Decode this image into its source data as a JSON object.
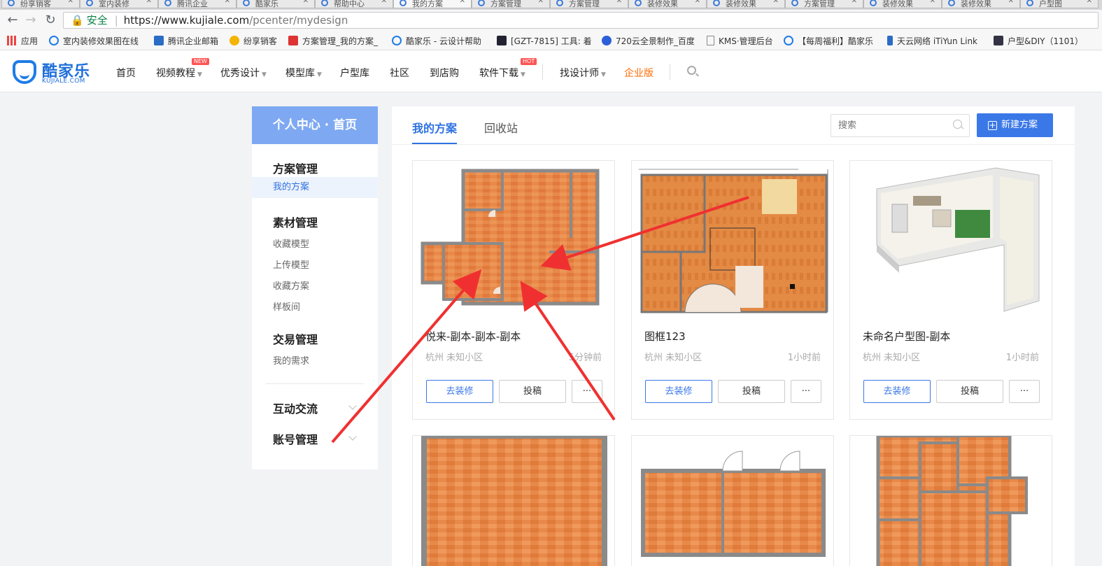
{
  "browser": {
    "tabs": [
      "纷享销客",
      "室内装修",
      "腾讯企业",
      "酷家乐",
      "帮助中心",
      "我的方案",
      "方案管理",
      "方案管理",
      "装修效果",
      "装修效果",
      "方案管理",
      "装修效果",
      "装修效果",
      "户型图"
    ],
    "address": {
      "secure_label": "安全",
      "host": "https://www.kujiale.com",
      "path": "/pcenter/mydesign"
    },
    "bookmarks": [
      "应用",
      "室内装修效果图在线",
      "腾讯企业邮箱",
      "纷享销客",
      "方案管理_我的方案_",
      "酷家乐 - 云设计帮助",
      "[GZT-7815] 工具: 着",
      "720云全景制作_百度",
      "KMS·管理后台",
      "【每周福利】酷家乐",
      "天云网络 iTiYun Link",
      "户型&DIY（1101）"
    ]
  },
  "header": {
    "logo_cn": "酷家乐",
    "logo_en": "KUJIALE.COM",
    "nav": [
      {
        "label": "首页",
        "caret": false
      },
      {
        "label": "视频教程",
        "caret": true,
        "badge": "NEW"
      },
      {
        "label": "优秀设计",
        "caret": true
      },
      {
        "label": "模型库",
        "caret": true
      },
      {
        "label": "户型库",
        "caret": false
      },
      {
        "label": "社区",
        "caret": false
      },
      {
        "label": "到店购",
        "caret": false
      },
      {
        "label": "软件下载",
        "caret": true,
        "badge": "HOT"
      },
      {
        "label": "找设计师",
        "caret": true
      },
      {
        "label": "企业版",
        "caret": false
      }
    ]
  },
  "sidebar": {
    "home": "个人中心 · 首页",
    "groups": [
      {
        "title": "方案管理",
        "items": [
          "我的方案"
        ]
      },
      {
        "title": "素材管理",
        "items": [
          "收藏模型",
          "上传模型",
          "收藏方案",
          "样板间"
        ]
      },
      {
        "title": "交易管理",
        "items": [
          "我的需求"
        ]
      }
    ],
    "collapsible": [
      "互动交流",
      "账号管理"
    ]
  },
  "main": {
    "tabs": [
      "我的方案",
      "回收站"
    ],
    "search_placeholder": "搜索",
    "new_button": "新建方案",
    "cards": [
      {
        "title": "悦来-副本-副本-副本",
        "location": "杭州 未知小区",
        "time": "5分钟前",
        "btn_decorate": "去装修",
        "btn_submit": "投稿",
        "btn_more": "···"
      },
      {
        "title": "图框123",
        "location": "杭州 未知小区",
        "time": "1小时前",
        "btn_decorate": "去装修",
        "btn_submit": "投稿",
        "btn_more": "···"
      },
      {
        "title": "未命名户型图-副本",
        "location": "杭州 未知小区",
        "time": "1小时前",
        "btn_decorate": "去装修",
        "btn_submit": "投稿",
        "btn_more": "···"
      }
    ]
  },
  "colors": {
    "accent": "#3b78e7",
    "sidebar_home": "#7ea9f2",
    "floor": "#e8894a",
    "wall": "#8a8a8a",
    "annotation": "#f03030",
    "enterprise": "#ff6a00"
  }
}
